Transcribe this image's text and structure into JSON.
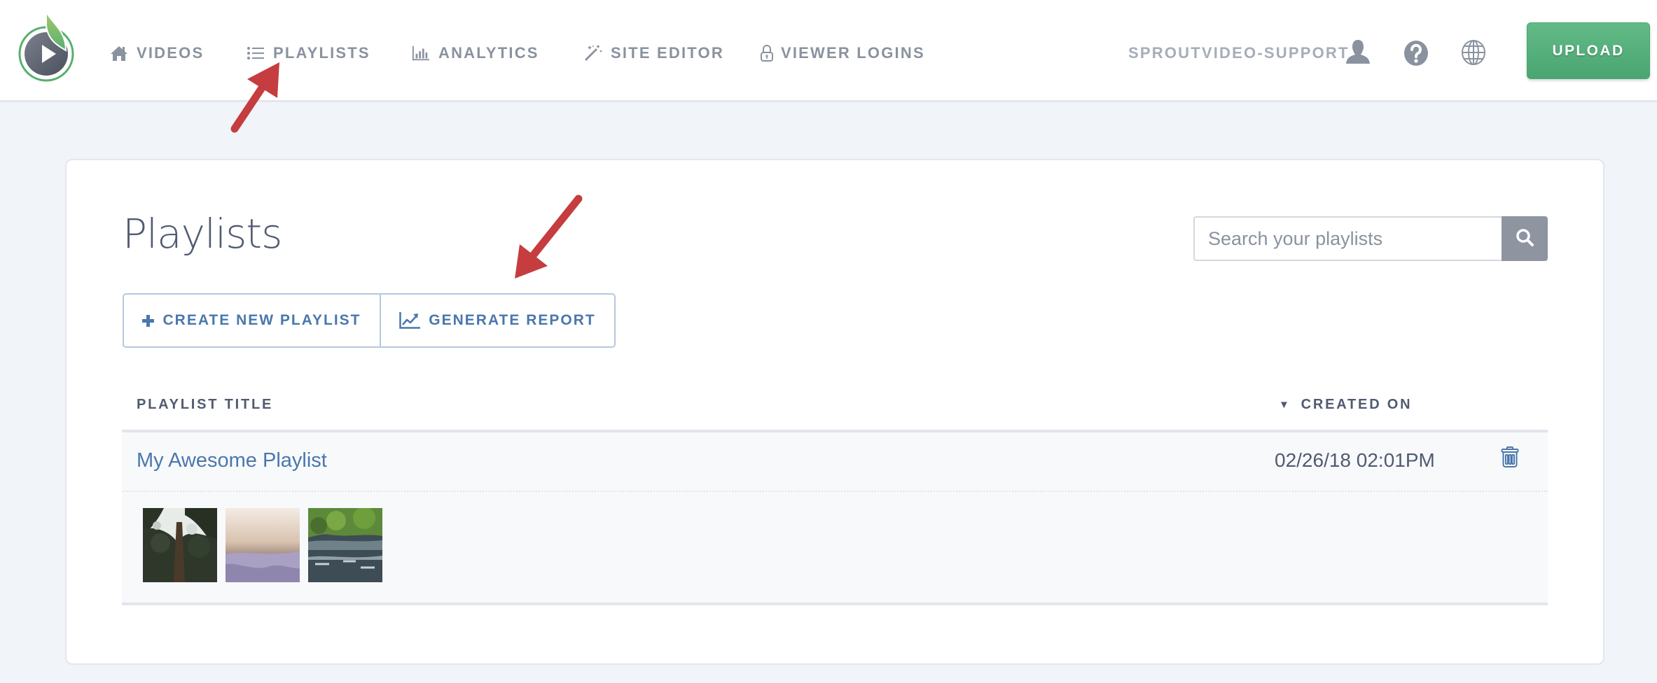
{
  "header": {
    "logo_label": "SproutVideo",
    "nav": [
      {
        "label": "VIDEOS",
        "icon": "home-icon"
      },
      {
        "label": "PLAYLISTS",
        "icon": "list-icon"
      },
      {
        "label": "ANALYTICS",
        "icon": "bar-chart-icon"
      },
      {
        "label": "SITE EDITOR",
        "icon": "magic-wand-icon"
      },
      {
        "label": "VIEWER LOGINS",
        "icon": "lock-icon"
      }
    ],
    "username": "SPROUTVIDEO-SUPPORT",
    "user_icon": "user-icon",
    "help_icon": "help-icon",
    "globe_icon": "globe-icon",
    "upload_label": "UPLOAD"
  },
  "page": {
    "title": "Playlists",
    "search": {
      "placeholder": "Search your playlists",
      "value": ""
    },
    "actions": {
      "create_label": "CREATE NEW PLAYLIST",
      "report_label": "GENERATE REPORT"
    }
  },
  "table": {
    "columns": {
      "title": "PLAYLIST TITLE",
      "created": "CREATED ON",
      "sort_indicator": "▼"
    },
    "rows": [
      {
        "title": "My Awesome Playlist",
        "created_on": "02/26/18 02:01PM",
        "thumbnails": [
          "forest-canopy-thumbnail",
          "misty-sunrise-thumbnail",
          "river-rapids-thumbnail"
        ]
      }
    ]
  },
  "colors": {
    "accent_blue": "#4a77ad",
    "upload_green": "#56b07c",
    "nav_gray": "#8a929f",
    "annotation_red": "#c53d3f",
    "page_bg": "#f1f4f8"
  }
}
